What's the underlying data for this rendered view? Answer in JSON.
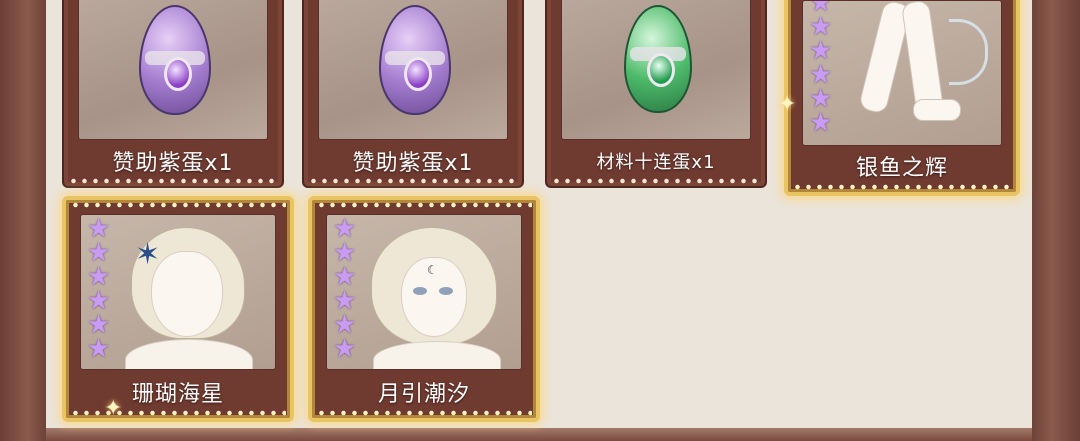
{
  "rewards": [
    {
      "id": "sponsor-purple-egg-1",
      "label": "赞助紫蛋x1",
      "type": "egg",
      "egg_color": "#a77fd1",
      "highlight": false
    },
    {
      "id": "sponsor-purple-egg-2",
      "label": "赞助紫蛋x1",
      "type": "egg",
      "egg_color": "#a77fd1",
      "highlight": false
    },
    {
      "id": "material-ten-egg",
      "label": "材料十连蛋x1",
      "type": "egg",
      "egg_color": "#4dbb6a",
      "highlight": false
    },
    {
      "id": "silver-fish-glow",
      "label": "银鱼之辉",
      "type": "costume",
      "stars": 6,
      "highlight": true
    },
    {
      "id": "coral-starfish",
      "label": "珊瑚海星",
      "type": "costume",
      "stars": 6,
      "highlight": true
    },
    {
      "id": "moon-tide",
      "label": "月引潮汐",
      "type": "costume",
      "stars": 6,
      "highlight": true
    }
  ],
  "colors": {
    "panel_bg": "#ebe4da",
    "card_frame": "#6f3a30",
    "gold_frame": "#e8c463",
    "star": "#c99bf2"
  },
  "icons": {
    "star": "★",
    "sparkle": "✦"
  }
}
